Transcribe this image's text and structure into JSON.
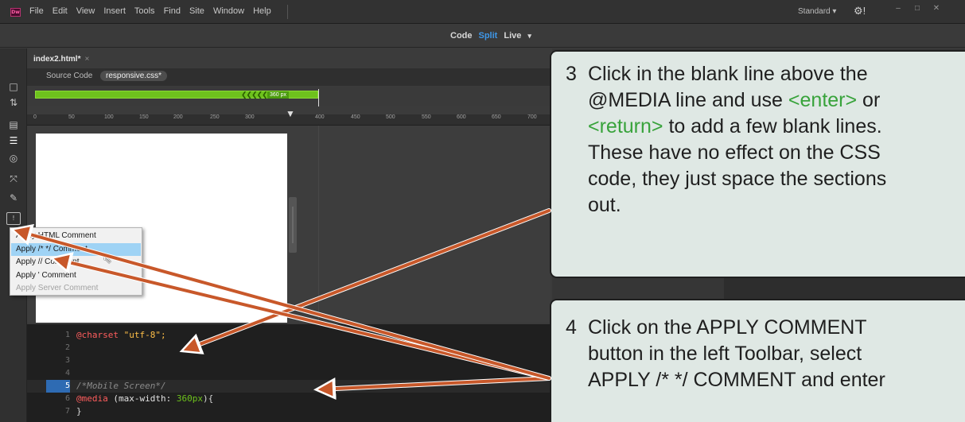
{
  "app": {
    "logo_text": "Dw",
    "menu": [
      "File",
      "Edit",
      "View",
      "Insert",
      "Tools",
      "Find",
      "Site",
      "Window",
      "Help"
    ],
    "workspace": "Standard ▾",
    "gear": "⚙!",
    "window_buttons": [
      "–",
      "□",
      "✕"
    ]
  },
  "view_switch": {
    "code": "Code",
    "split": "Split",
    "live": "Live",
    "caret": "▾"
  },
  "document": {
    "tab_label": "index2.html*",
    "tab_close": "×",
    "related_files": [
      "Source Code",
      "responsive.css*"
    ],
    "active_related": "responsive.css*",
    "media_query_label": "360 px",
    "media_query_arrows": "❮❮❮❮❮"
  },
  "ruler": {
    "marks": [
      "0",
      "50",
      "100",
      "150",
      "200",
      "250",
      "300",
      "400",
      "450",
      "500",
      "550",
      "600",
      "650",
      "700"
    ],
    "marker": "▼"
  },
  "toolbar": {
    "icons": [
      "document-icon",
      "sort-icon",
      "snippet-icon",
      "indent-icon",
      "target-icon",
      "expand-icon",
      "format-icon",
      "comment-icon"
    ],
    "glyphs": [
      "□",
      "⇅",
      "▤",
      "☰",
      "◎",
      "⤧",
      "✎",
      "!"
    ]
  },
  "context_menu": {
    "items": [
      "Apply HTML Comment",
      "Apply /* */ Comment",
      "Apply // Comment",
      "Apply ' Comment",
      "Apply Server Comment"
    ],
    "selected_index": 1,
    "disabled_index": 4
  },
  "code": {
    "lines": [
      {
        "num": "1",
        "parts": [
          {
            "t": "@charset ",
            "c": "tok-at"
          },
          {
            "t": "\"utf-8\";",
            "c": "tok-str"
          }
        ]
      },
      {
        "num": "2",
        "parts": []
      },
      {
        "num": "3",
        "parts": []
      },
      {
        "num": "4",
        "parts": []
      },
      {
        "num": "5",
        "parts": [
          {
            "t": "/*Mobile Screen*/",
            "c": "tok-com"
          }
        ]
      },
      {
        "num": "6",
        "parts": [
          {
            "t": "@media ",
            "c": "tok-at"
          },
          {
            "t": "(max-width: ",
            "c": "tok-prop"
          },
          {
            "t": "360px",
            "c": "tok-num"
          },
          {
            "t": "){",
            "c": "tok-brace"
          }
        ]
      },
      {
        "num": "7",
        "parts": [
          {
            "t": "}",
            "c": "tok-brace"
          }
        ]
      }
    ],
    "current_line": "5"
  },
  "callouts": {
    "step3_num": "3",
    "step3_a": "Click in the blank line above the",
    "step3_b": "@MEDIA line and use ",
    "step3_enter": "<enter>",
    "step3_c": " or",
    "step3_return": "<return>",
    "step3_d": " to add a few blank lines.",
    "step3_e": "These have no effect on the CSS",
    "step3_f": "code, they just space the sections",
    "step3_g": "out.",
    "step4_num": "4",
    "step4_a": "Click on the APPLY COMMENT",
    "step4_b": "button in the left Toolbar, select",
    "step4_c": "APPLY /* */ COMMENT and enter"
  },
  "colors": {
    "accent_blue": "#3e97e8",
    "media_query_green": "#6ec21d",
    "arrow": "#c8582a",
    "callout_bg": "#dfe8e4",
    "keyword_green": "#38a33b"
  }
}
